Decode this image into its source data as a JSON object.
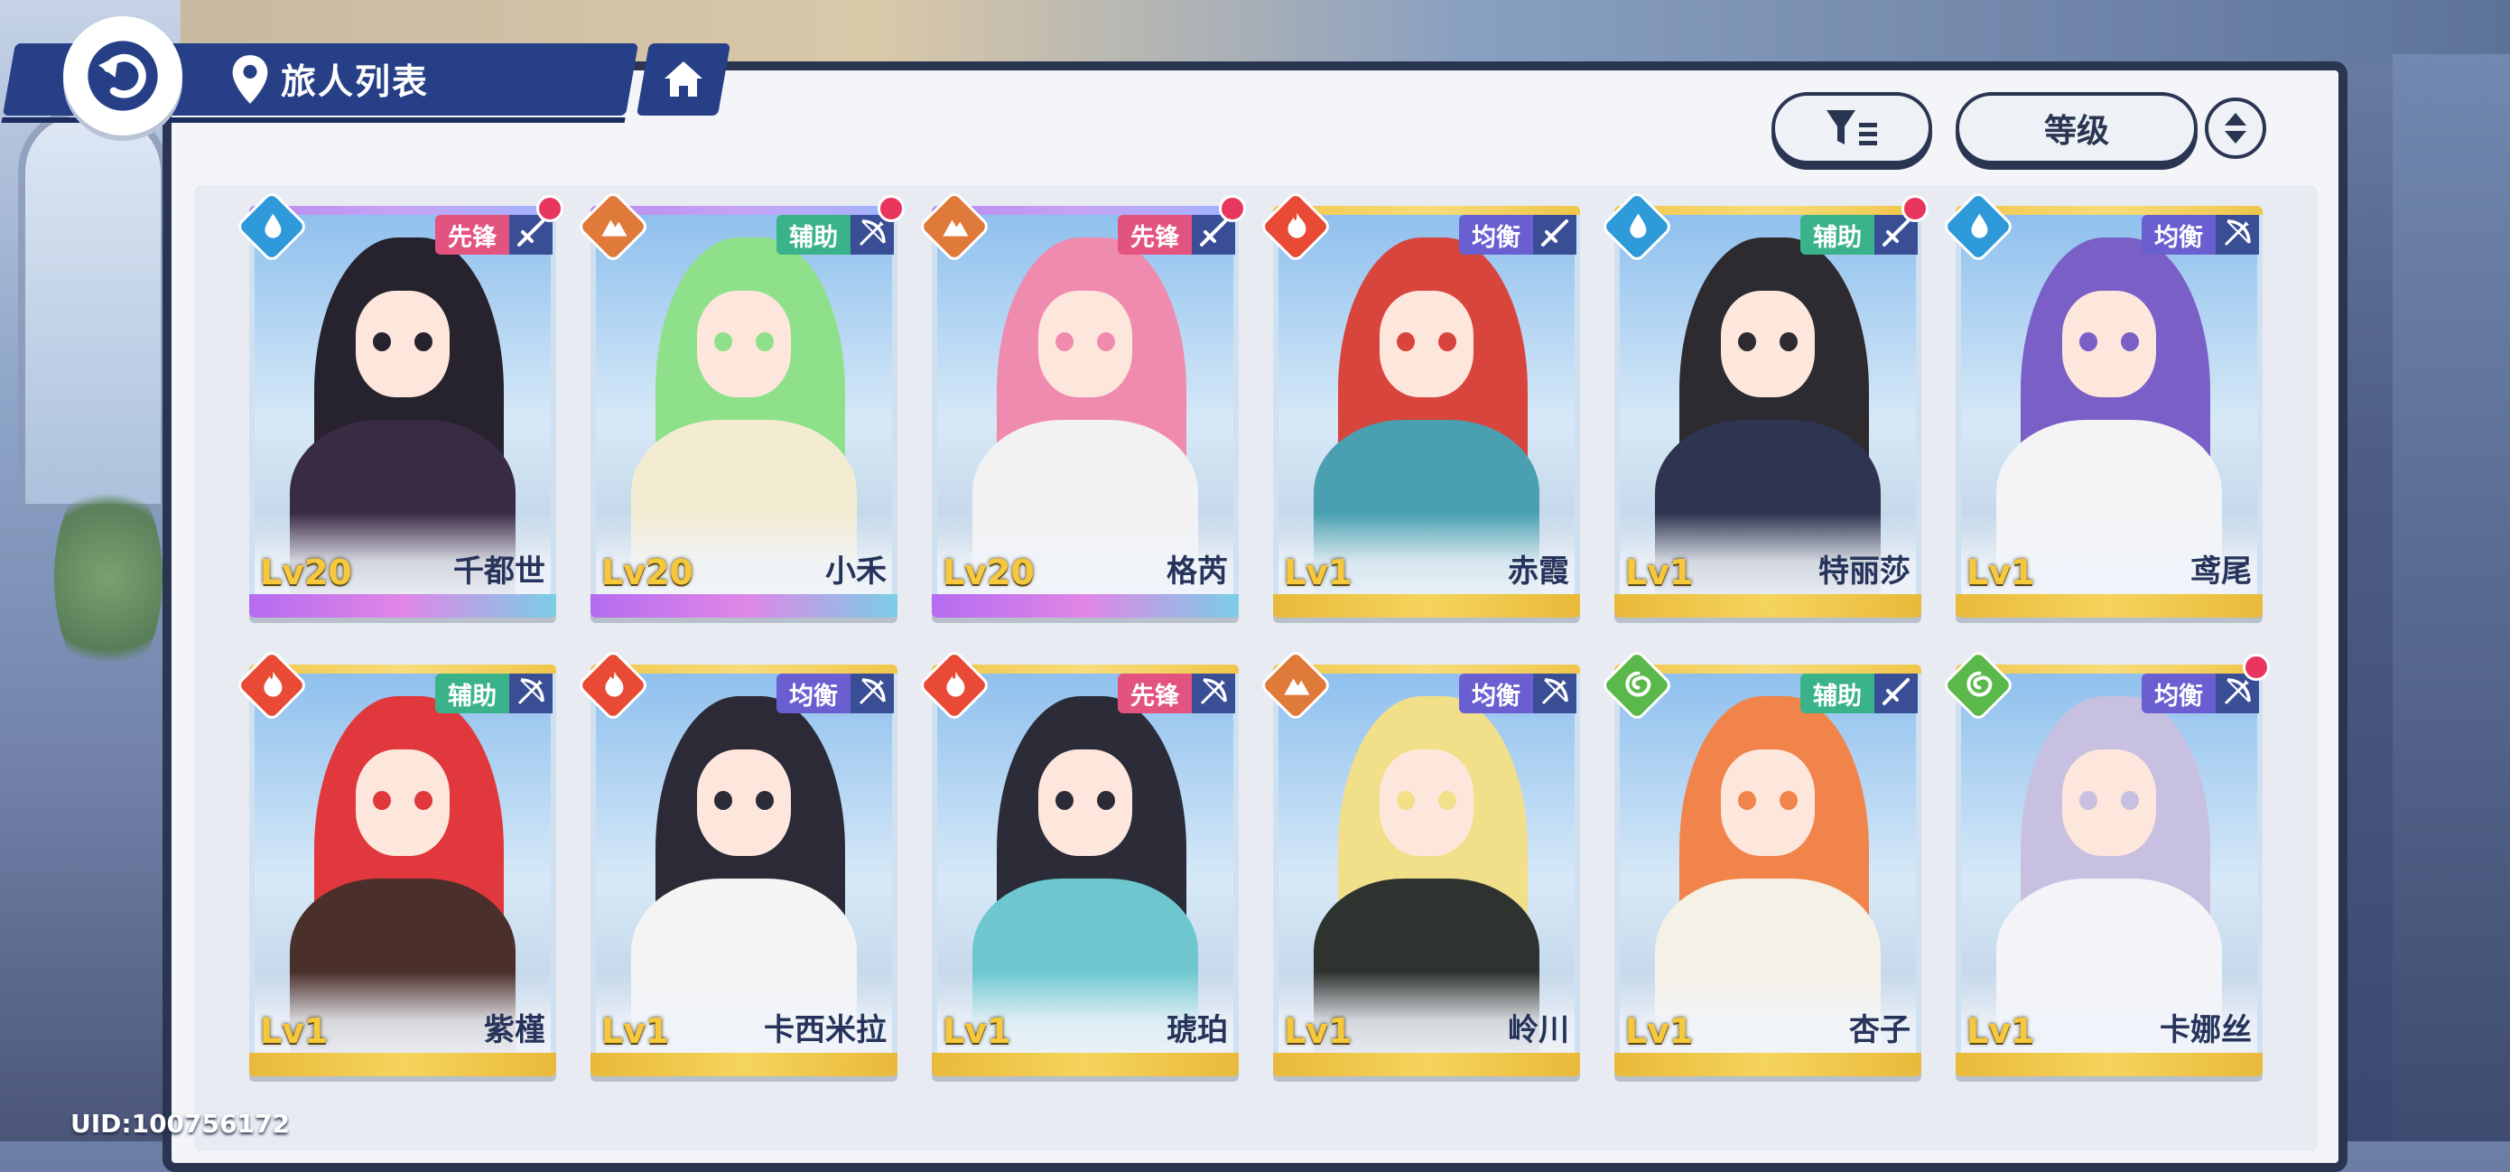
{
  "header": {
    "title": "旅人列表"
  },
  "sort": {
    "label": "等级"
  },
  "uid": "UID:100756172",
  "colors": {
    "navy": "#263f86",
    "role_pink": "#e3537f",
    "role_green": "#3bb38a",
    "role_purple": "#6a5fd1",
    "weapon_blue": "#3a4e96",
    "level_gold": "#f6c83a",
    "new_dot": "#e8365e"
  },
  "characters": [
    {
      "name": "千都世",
      "level": "Lv20",
      "role": "先锋",
      "role_color": "#e3537f",
      "element": "water-icon",
      "element_color": "#2f9ad9",
      "weapon": "sword-icon",
      "new": true,
      "frame": "purple",
      "hair": "#26222e",
      "body": "#3a2b45"
    },
    {
      "name": "小禾",
      "level": "Lv20",
      "role": "辅助",
      "role_color": "#3bb38a",
      "element": "earth-icon",
      "element_color": "#e07a3a",
      "weapon": "bow-icon",
      "new": true,
      "frame": "purple",
      "hair": "#8fe08a",
      "body": "#f3ecd2"
    },
    {
      "name": "格芮",
      "level": "Lv20",
      "role": "先锋",
      "role_color": "#e3537f",
      "element": "earth-icon",
      "element_color": "#e07a3a",
      "weapon": "sword-icon",
      "new": true,
      "frame": "purple",
      "hair": "#f08bb0",
      "body": "#f2f2f2"
    },
    {
      "name": "赤霞",
      "level": "Lv1",
      "role": "均衡",
      "role_color": "#6a5fd1",
      "element": "fire-icon",
      "element_color": "#e84a35",
      "weapon": "sword-icon",
      "new": false,
      "frame": "gold",
      "hair": "#d8453d",
      "body": "#4aa0b0"
    },
    {
      "name": "特丽莎",
      "level": "Lv1",
      "role": "辅助",
      "role_color": "#3bb38a",
      "element": "water-icon",
      "element_color": "#2f9ad9",
      "weapon": "sword-icon",
      "new": true,
      "frame": "gold",
      "hair": "#2d2a30",
      "body": "#2f3550"
    },
    {
      "name": "鸢尾",
      "level": "Lv1",
      "role": "均衡",
      "role_color": "#6a5fd1",
      "element": "water-icon",
      "element_color": "#2f9ad9",
      "weapon": "bow-icon",
      "new": false,
      "frame": "gold",
      "hair": "#7a5fc6",
      "body": "#f4f4f6"
    },
    {
      "name": "紫槿",
      "level": "Lv1",
      "role": "辅助",
      "role_color": "#3bb38a",
      "element": "fire-icon",
      "element_color": "#e84a35",
      "weapon": "bow-icon",
      "new": false,
      "frame": "gold",
      "hair": "#e0383c",
      "body": "#4a2f2a"
    },
    {
      "name": "卡西米拉",
      "level": "Lv1",
      "role": "均衡",
      "role_color": "#6a5fd1",
      "element": "fire-icon",
      "element_color": "#e84a35",
      "weapon": "bow-icon",
      "new": false,
      "frame": "gold",
      "hair": "#2b2a36",
      "body": "#f4f4f4"
    },
    {
      "name": "琥珀",
      "level": "Lv1",
      "role": "先锋",
      "role_color": "#e3537f",
      "element": "fire-icon",
      "element_color": "#e84a35",
      "weapon": "bow-icon",
      "new": false,
      "frame": "gold",
      "hair": "#2b2c38",
      "body": "#6ec7cf"
    },
    {
      "name": "岭川",
      "level": "Lv1",
      "role": "均衡",
      "role_color": "#6a5fd1",
      "element": "earth-icon",
      "element_color": "#e07a3a",
      "weapon": "bow-icon",
      "new": false,
      "frame": "gold",
      "hair": "#f2df8a",
      "body": "#2e3330"
    },
    {
      "name": "杏子",
      "level": "Lv1",
      "role": "辅助",
      "role_color": "#3bb38a",
      "element": "wind-icon",
      "element_color": "#5ab94a",
      "weapon": "sword-icon",
      "new": false,
      "frame": "gold",
      "hair": "#f0844a",
      "body": "#f6f1e6"
    },
    {
      "name": "卡娜丝",
      "level": "Lv1",
      "role": "均衡",
      "role_color": "#6a5fd1",
      "element": "wind-icon",
      "element_color": "#5ab94a",
      "weapon": "bow-icon",
      "new": true,
      "frame": "gold",
      "hair": "#c8c0e0",
      "body": "#f4f4f8"
    }
  ]
}
